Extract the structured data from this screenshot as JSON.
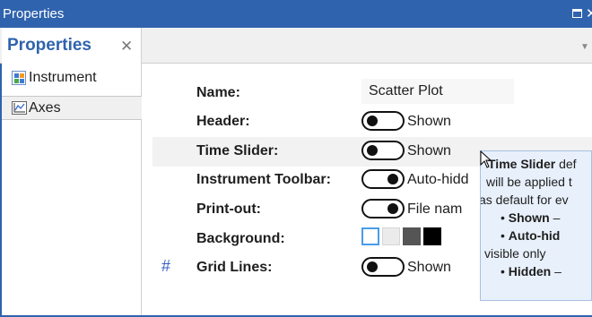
{
  "window": {
    "title": "Properties"
  },
  "tab": {
    "label": "Properties"
  },
  "sidebar": {
    "items": [
      {
        "label": "Instrument"
      },
      {
        "label": "Axes"
      }
    ]
  },
  "properties": [
    {
      "label": "Name:",
      "value": "Scatter Plot"
    },
    {
      "label": "Header:",
      "value": "Shown",
      "toggle": "left"
    },
    {
      "label": "Time Slider:",
      "value": "Shown",
      "toggle": "left"
    },
    {
      "label": "Instrument Toolbar:",
      "value": "Auto-hidd",
      "toggle": "right"
    },
    {
      "label": "Print-out:",
      "value": "File nam",
      "toggle": "right"
    },
    {
      "label": "Background:",
      "swatches": [
        "#ffffff",
        "#ebebeb",
        "#555555",
        "#000000"
      ]
    },
    {
      "label": "Grid Lines:",
      "value": "Shown",
      "toggle": "left"
    }
  ],
  "tooltip": {
    "line1_bold": "Time Slider",
    "line1_rest": " def",
    "line2": "will be applied t",
    "line3": "as default for ev",
    "item1_bold": "Shown",
    "item1_rest": " –",
    "item2_bold": "Auto-hid",
    "line6": "visible only",
    "item3_bold": "Hidden",
    "item3_rest": " –"
  },
  "colors": {
    "accent": "#2f63ad",
    "tooltip_bg": "#e8f0fb",
    "row_hover": "#f2f2f2"
  },
  "icons": [
    "maximize-icon",
    "close-icon",
    "menu-icon",
    "instrument-icon",
    "axes-icon",
    "grid-lines-icon",
    "cursor-icon"
  ]
}
